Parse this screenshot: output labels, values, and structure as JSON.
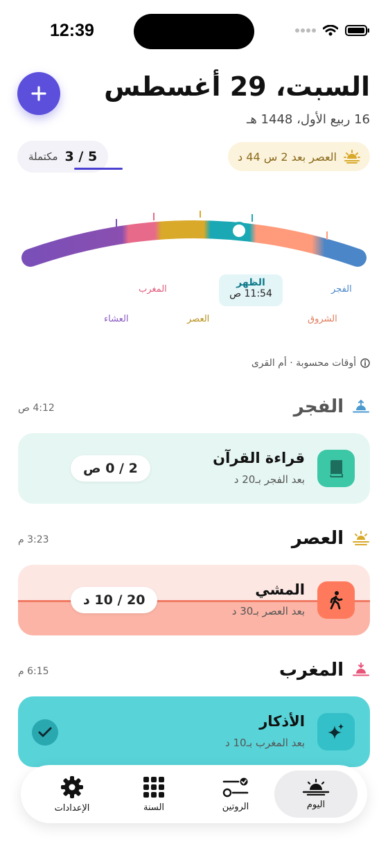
{
  "status_bar": {
    "time": "12:39"
  },
  "header": {
    "title": "السبت، 29 أغسطس",
    "hijri_date": "16 ربيع الأول، 1448 هـ"
  },
  "next_prayer": {
    "text": "العصر بعد 2 س 44 د",
    "icon": "sunrise-icon"
  },
  "progress": {
    "count": "5 / 3",
    "label": "مكتملة",
    "completed": 3,
    "total": 5
  },
  "arc": {
    "labels": {
      "fajr": "الفجر",
      "sunrise": "الشروق",
      "dhuhr": "الظهر",
      "dhuhr_time": "11:54 ص",
      "asr": "العصر",
      "maghrib": "المغرب",
      "isha": "العشاء"
    },
    "colors": {
      "fajr": "#4a86c8",
      "sunrise": "#ff9a7a",
      "dhuhr": "#1aa8b4",
      "asr": "#d9a92a",
      "maghrib": "#e86a8a",
      "isha": "#7a4fb8"
    }
  },
  "calc_note": "أوقات محسوبة · أم القرى",
  "sections": [
    {
      "name": "الفجر",
      "time": "4:12 ص",
      "icon": "sunrise-icon",
      "icon_color": "#4a9ad0",
      "card": {
        "title": "قراءة القرآن",
        "subtitle": "بعد الفجر بـ20 د",
        "counter": "2 / 0 ص",
        "icon": "book-icon",
        "bg": "#e6f7f3",
        "icon_bg": "#3cc7a6"
      }
    },
    {
      "name": "العصر",
      "time": "3:23 م",
      "icon": "sun-icon",
      "icon_color": "#d9a92a",
      "card": {
        "title": "المشي",
        "subtitle": "بعد العصر بـ30 د",
        "counter": "20 / 10 د",
        "icon": "walking-icon",
        "bg": "#fde7e3",
        "fill": "#fbb4a5",
        "progress": 0.5,
        "icon_bg": "#ff7a5c"
      }
    },
    {
      "name": "المغرب",
      "time": "6:15 م",
      "icon": "sunset-icon",
      "icon_color": "#e8557a",
      "card": {
        "title": "الأذكار",
        "subtitle": "بعد المغرب بـ10 د",
        "icon": "sparkles-icon",
        "bg": "#58d3d8",
        "icon_bg": "#34c0c8",
        "done": true
      }
    }
  ],
  "tabs": [
    {
      "label": "اليوم",
      "icon": "sunrise-icon",
      "active": true
    },
    {
      "label": "الروتين",
      "icon": "routine-icon",
      "active": false
    },
    {
      "label": "السنة",
      "icon": "grid-icon",
      "active": false
    },
    {
      "label": "الإعدادات",
      "icon": "gear-icon",
      "active": false
    }
  ]
}
